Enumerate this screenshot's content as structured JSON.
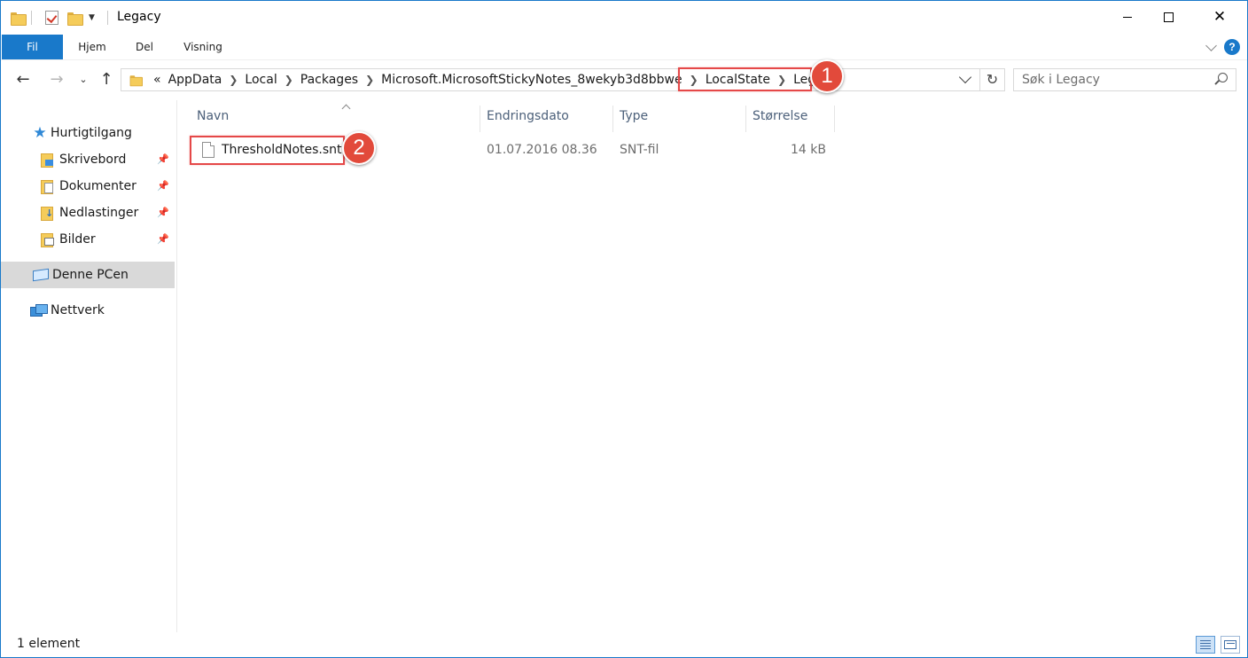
{
  "window": {
    "title": "Legacy"
  },
  "ribbon": {
    "tabs": [
      "Fil",
      "Hjem",
      "Del",
      "Visning"
    ],
    "help_label": "?"
  },
  "address": {
    "overflow_marker": "«",
    "breadcrumbs": [
      "AppData",
      "Local",
      "Packages",
      "Microsoft.MicrosoftStickyNotes_8wekyb3d8bbwe",
      "LocalState",
      "Legacy"
    ]
  },
  "search": {
    "placeholder": "Søk i Legacy"
  },
  "nav": {
    "quick_access": "Hurtigtilgang",
    "pinned": [
      "Skrivebord",
      "Dokumenter",
      "Nedlastinger",
      "Bilder"
    ],
    "this_pc": "Denne PCen",
    "network": "Nettverk"
  },
  "columns": {
    "name": "Navn",
    "date": "Endringsdato",
    "type": "Type",
    "size": "Størrelse"
  },
  "files": [
    {
      "name": "ThresholdNotes.snt",
      "date": "01.07.2016 08.36",
      "type": "SNT-fil",
      "size": "14 kB"
    }
  ],
  "annotations": {
    "badge1": "1",
    "badge2": "2",
    "color": "#e24a3b"
  },
  "status": {
    "count": "1 element"
  },
  "colors": {
    "accent": "#1979ca"
  }
}
